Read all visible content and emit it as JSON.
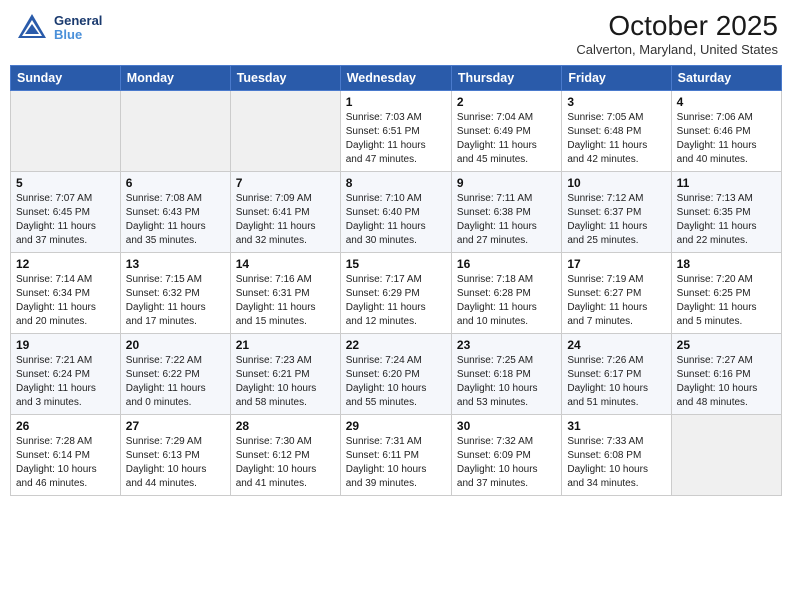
{
  "header": {
    "logo": {
      "line1": "General",
      "line2": "Blue"
    },
    "title": "October 2025",
    "location": "Calverton, Maryland, United States"
  },
  "days_of_week": [
    "Sunday",
    "Monday",
    "Tuesday",
    "Wednesday",
    "Thursday",
    "Friday",
    "Saturday"
  ],
  "weeks": [
    [
      {
        "day": "",
        "info": ""
      },
      {
        "day": "",
        "info": ""
      },
      {
        "day": "",
        "info": ""
      },
      {
        "day": "1",
        "info": "Sunrise: 7:03 AM\nSunset: 6:51 PM\nDaylight: 11 hours\nand 47 minutes."
      },
      {
        "day": "2",
        "info": "Sunrise: 7:04 AM\nSunset: 6:49 PM\nDaylight: 11 hours\nand 45 minutes."
      },
      {
        "day": "3",
        "info": "Sunrise: 7:05 AM\nSunset: 6:48 PM\nDaylight: 11 hours\nand 42 minutes."
      },
      {
        "day": "4",
        "info": "Sunrise: 7:06 AM\nSunset: 6:46 PM\nDaylight: 11 hours\nand 40 minutes."
      }
    ],
    [
      {
        "day": "5",
        "info": "Sunrise: 7:07 AM\nSunset: 6:45 PM\nDaylight: 11 hours\nand 37 minutes."
      },
      {
        "day": "6",
        "info": "Sunrise: 7:08 AM\nSunset: 6:43 PM\nDaylight: 11 hours\nand 35 minutes."
      },
      {
        "day": "7",
        "info": "Sunrise: 7:09 AM\nSunset: 6:41 PM\nDaylight: 11 hours\nand 32 minutes."
      },
      {
        "day": "8",
        "info": "Sunrise: 7:10 AM\nSunset: 6:40 PM\nDaylight: 11 hours\nand 30 minutes."
      },
      {
        "day": "9",
        "info": "Sunrise: 7:11 AM\nSunset: 6:38 PM\nDaylight: 11 hours\nand 27 minutes."
      },
      {
        "day": "10",
        "info": "Sunrise: 7:12 AM\nSunset: 6:37 PM\nDaylight: 11 hours\nand 25 minutes."
      },
      {
        "day": "11",
        "info": "Sunrise: 7:13 AM\nSunset: 6:35 PM\nDaylight: 11 hours\nand 22 minutes."
      }
    ],
    [
      {
        "day": "12",
        "info": "Sunrise: 7:14 AM\nSunset: 6:34 PM\nDaylight: 11 hours\nand 20 minutes."
      },
      {
        "day": "13",
        "info": "Sunrise: 7:15 AM\nSunset: 6:32 PM\nDaylight: 11 hours\nand 17 minutes."
      },
      {
        "day": "14",
        "info": "Sunrise: 7:16 AM\nSunset: 6:31 PM\nDaylight: 11 hours\nand 15 minutes."
      },
      {
        "day": "15",
        "info": "Sunrise: 7:17 AM\nSunset: 6:29 PM\nDaylight: 11 hours\nand 12 minutes."
      },
      {
        "day": "16",
        "info": "Sunrise: 7:18 AM\nSunset: 6:28 PM\nDaylight: 11 hours\nand 10 minutes."
      },
      {
        "day": "17",
        "info": "Sunrise: 7:19 AM\nSunset: 6:27 PM\nDaylight: 11 hours\nand 7 minutes."
      },
      {
        "day": "18",
        "info": "Sunrise: 7:20 AM\nSunset: 6:25 PM\nDaylight: 11 hours\nand 5 minutes."
      }
    ],
    [
      {
        "day": "19",
        "info": "Sunrise: 7:21 AM\nSunset: 6:24 PM\nDaylight: 11 hours\nand 3 minutes."
      },
      {
        "day": "20",
        "info": "Sunrise: 7:22 AM\nSunset: 6:22 PM\nDaylight: 11 hours\nand 0 minutes."
      },
      {
        "day": "21",
        "info": "Sunrise: 7:23 AM\nSunset: 6:21 PM\nDaylight: 10 hours\nand 58 minutes."
      },
      {
        "day": "22",
        "info": "Sunrise: 7:24 AM\nSunset: 6:20 PM\nDaylight: 10 hours\nand 55 minutes."
      },
      {
        "day": "23",
        "info": "Sunrise: 7:25 AM\nSunset: 6:18 PM\nDaylight: 10 hours\nand 53 minutes."
      },
      {
        "day": "24",
        "info": "Sunrise: 7:26 AM\nSunset: 6:17 PM\nDaylight: 10 hours\nand 51 minutes."
      },
      {
        "day": "25",
        "info": "Sunrise: 7:27 AM\nSunset: 6:16 PM\nDaylight: 10 hours\nand 48 minutes."
      }
    ],
    [
      {
        "day": "26",
        "info": "Sunrise: 7:28 AM\nSunset: 6:14 PM\nDaylight: 10 hours\nand 46 minutes."
      },
      {
        "day": "27",
        "info": "Sunrise: 7:29 AM\nSunset: 6:13 PM\nDaylight: 10 hours\nand 44 minutes."
      },
      {
        "day": "28",
        "info": "Sunrise: 7:30 AM\nSunset: 6:12 PM\nDaylight: 10 hours\nand 41 minutes."
      },
      {
        "day": "29",
        "info": "Sunrise: 7:31 AM\nSunset: 6:11 PM\nDaylight: 10 hours\nand 39 minutes."
      },
      {
        "day": "30",
        "info": "Sunrise: 7:32 AM\nSunset: 6:09 PM\nDaylight: 10 hours\nand 37 minutes."
      },
      {
        "day": "31",
        "info": "Sunrise: 7:33 AM\nSunset: 6:08 PM\nDaylight: 10 hours\nand 34 minutes."
      },
      {
        "day": "",
        "info": ""
      }
    ]
  ]
}
